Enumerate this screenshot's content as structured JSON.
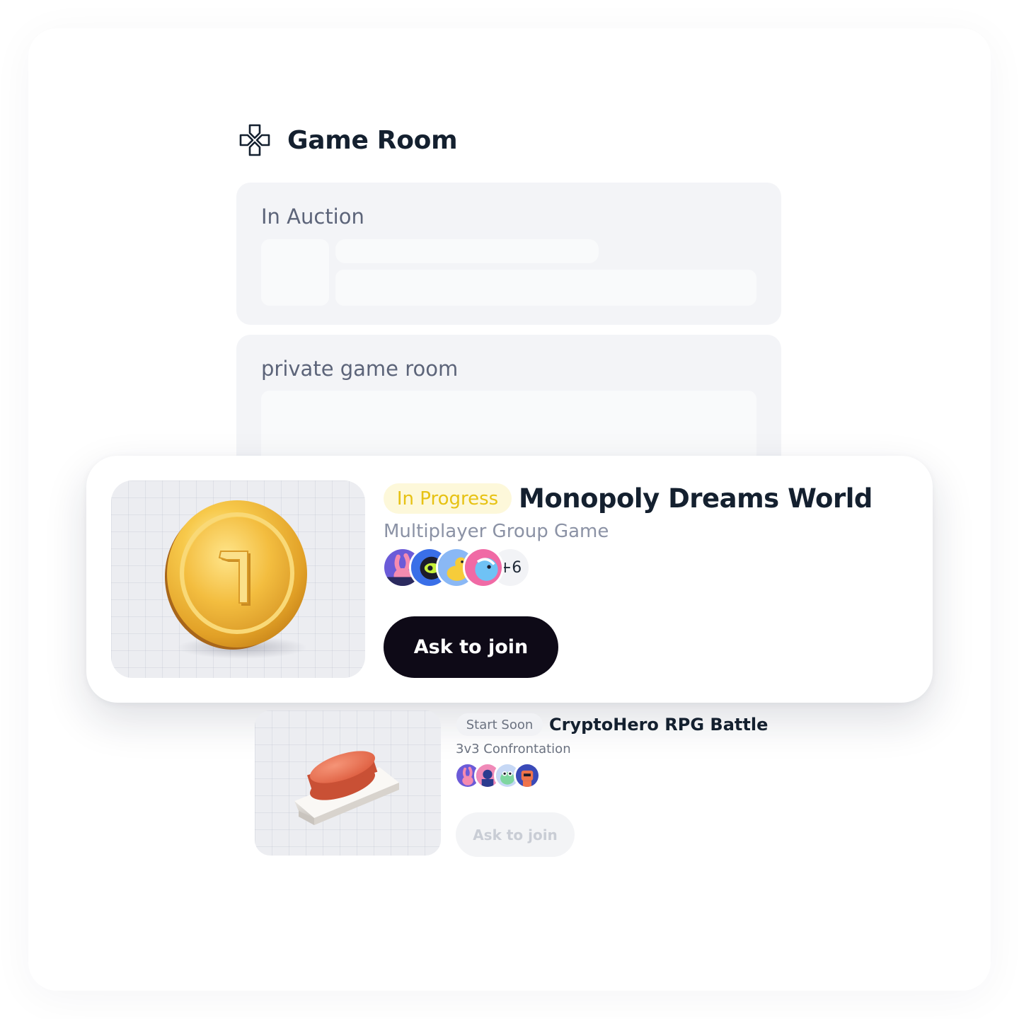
{
  "header": {
    "title": "Game Room",
    "icon": "gamepad-dpad-icon"
  },
  "sections": {
    "auction": {
      "label": "In Auction"
    },
    "private": {
      "label": "private game room"
    }
  },
  "featured_game": {
    "status": "In Progress",
    "title": "Monopoly Dreams World",
    "subtitle": "Multiplayer Group Game",
    "more_players": "+6",
    "cta": "Ask to join",
    "colors": {
      "status_bg": "#fdf8da",
      "status_text": "#e7c214",
      "cta_bg": "#0e0a17",
      "cta_text": "#ffffff"
    }
  },
  "secondary_game": {
    "status": "Start Soon",
    "title": "CryptoHero RPG Battle",
    "subtitle": "3v3 Confrontation",
    "cta": "Ask to join",
    "colors": {
      "status_bg": "#f1f2f5",
      "status_text": "#6b7280",
      "cta_bg": "#f3f4f6",
      "cta_text": "#c9cdd5"
    }
  }
}
